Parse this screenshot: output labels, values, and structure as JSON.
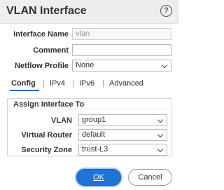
{
  "dialog": {
    "title": "VLAN Interface",
    "help_glyph": "?"
  },
  "fields": {
    "interface_name": {
      "label": "Interface Name",
      "value": "vlan"
    },
    "comment": {
      "label": "Comment",
      "value": ""
    },
    "netflow_profile": {
      "label": "Netflow Profile",
      "value": "None"
    }
  },
  "tabs": [
    {
      "label": "Config",
      "active": true
    },
    {
      "label": "IPv4"
    },
    {
      "label": "IPv6"
    },
    {
      "label": "Advanced"
    }
  ],
  "assign": {
    "title": "Assign Interface To",
    "vlan": {
      "label": "VLAN",
      "value": "group1"
    },
    "virtual_router": {
      "label": "Virtual Router",
      "value": "default"
    },
    "security_zone": {
      "label": "Security Zone",
      "value": "trust-L3"
    }
  },
  "buttons": {
    "ok": "OK",
    "cancel": "Cancel"
  },
  "colors": {
    "accent": "#1f73d6",
    "titlebar": "#eeeeee"
  }
}
